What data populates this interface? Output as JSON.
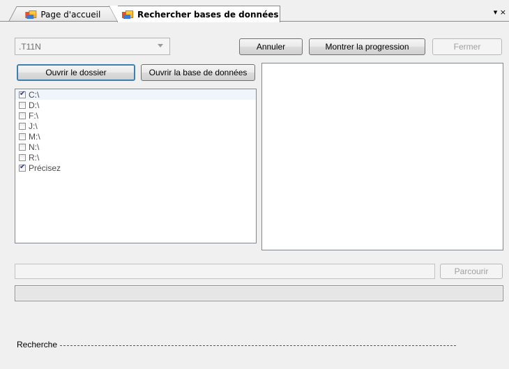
{
  "tabs": [
    {
      "label": "Page d'accueil",
      "icon": "app-icon",
      "active": false
    },
    {
      "label": "Rechercher bases de données",
      "icon": "app-icon",
      "active": true
    }
  ],
  "tab_menu_label": "▾ ×",
  "extension_combo": {
    "value": ".T11N"
  },
  "buttons": {
    "cancel": "Annuler",
    "show_progress": "Montrer la progression",
    "close": "Fermer",
    "open_folder": "Ouvrir le dossier",
    "open_database": "Ouvrir la base de données",
    "browse": "Parcourir"
  },
  "drives": [
    {
      "label": "C:\\",
      "checked": true
    },
    {
      "label": "D:\\",
      "checked": false
    },
    {
      "label": "F:\\",
      "checked": false
    },
    {
      "label": "J:\\",
      "checked": false
    },
    {
      "label": "M:\\",
      "checked": false
    },
    {
      "label": "N:\\",
      "checked": false
    },
    {
      "label": "R:\\",
      "checked": false
    },
    {
      "label": "Précisez",
      "checked": true
    }
  ],
  "path_field": {
    "value": ""
  },
  "progress": {
    "value": 0
  },
  "status": {
    "label": "Recherche"
  }
}
